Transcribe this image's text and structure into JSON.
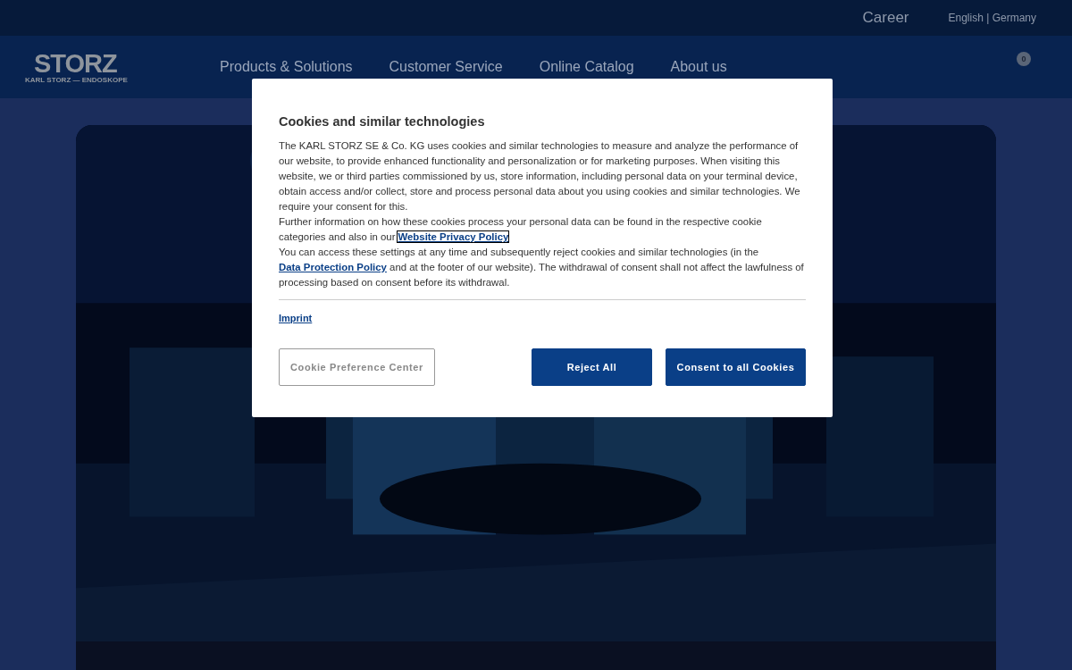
{
  "top_bar": {
    "links": [
      {
        "label": "Career"
      },
      {
        "label": "English | Germany"
      }
    ]
  },
  "header": {
    "logo": {
      "wordmark": "STORZ",
      "tagline": "KARL STORZ — ENDOSKOPE"
    },
    "nav": [
      {
        "label": "Products & Solutions"
      },
      {
        "label": "Customer Service"
      },
      {
        "label": "Online Catalog"
      },
      {
        "label": "About us"
      }
    ],
    "cart_count": "0"
  },
  "cookie_dialog": {
    "title": "Cookies and similar technologies",
    "paragraphs": [
      [
        {
          "text": "The KARL STORZ SE & Co. KG uses cookies and similar technologies to measure and analyze the performance of our website, to provide enhanced functionality and personalization or for marketing purposes. When visiting this website, we or third parties commissioned by us, store information, including personal data on your terminal device, obtain access and/or collect, store and process personal data about you using cookies and similar technologies. We require your consent for this."
        }
      ],
      [
        {
          "text": "Further information on how these cookies process your personal data can be found in the respective cookie categories and also in our"
        },
        {
          "link": "Website Privacy Policy",
          "focused": true
        }
      ],
      [
        {
          "text": "You can access these settings at any time and subsequently reject cookies and similar technologies (in the "
        },
        {
          "link": "Data Protection Policy",
          "focused": false
        },
        {
          "text": " and at the footer of our website). The withdrawal of consent shall not affect the lawfulness of processing based on consent before its withdrawal."
        }
      ]
    ],
    "imprint": "Imprint",
    "buttons": [
      {
        "label": "Cookie Preference Center",
        "kind": "outline"
      },
      {
        "label": "Reject All",
        "kind": "primary"
      },
      {
        "label": "Consent to all Cookies",
        "kind": "primary"
      }
    ]
  }
}
